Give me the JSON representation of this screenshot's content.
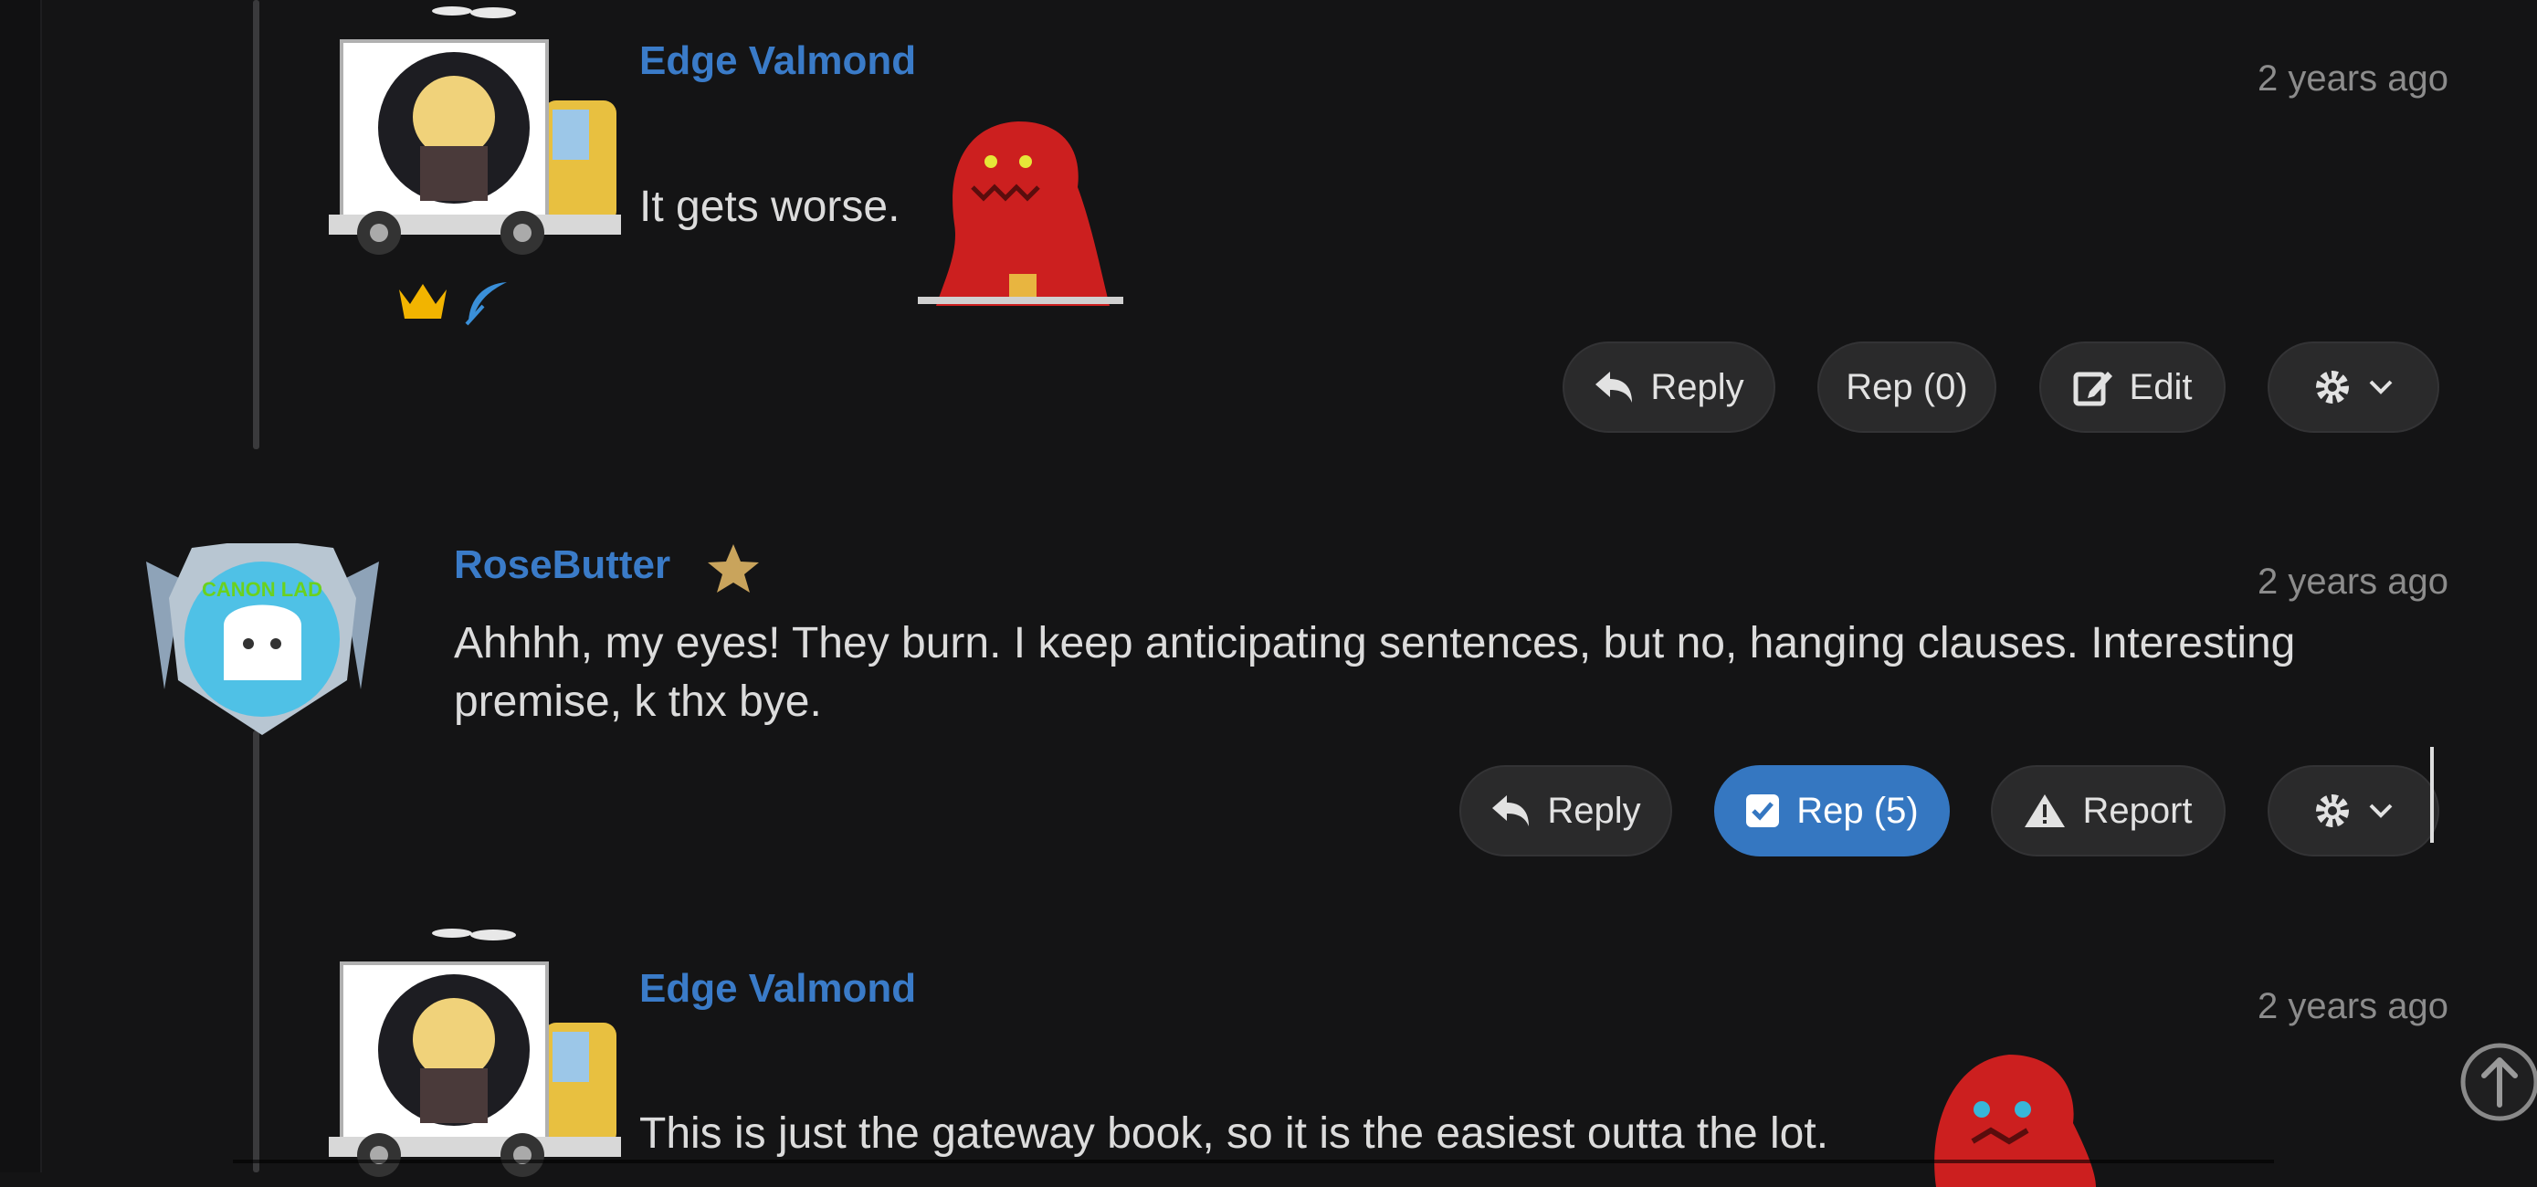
{
  "comments": [
    {
      "author": "Edge Valmond",
      "time": "2 years ago",
      "text": "It gets worse.",
      "badges": [
        "crown-icon",
        "feather-icon"
      ],
      "actions": {
        "reply": "Reply",
        "rep": "Rep (0)",
        "edit": "Edit"
      }
    },
    {
      "author": "RoseButter",
      "time": "2 years ago",
      "text_line1": "Ahhhh, my eyes! They burn. I keep anticipating sentences, but no, hanging clauses. Interesting",
      "text_line2": "premise, k thx bye.",
      "emblem_text": "CANON LAD",
      "actions": {
        "reply": "Reply",
        "rep": "Rep (5)",
        "report": "Report"
      }
    },
    {
      "author": "Edge Valmond",
      "time": "2 years ago",
      "text": "This is just the gateway book, so it is the easiest outta the lot."
    }
  ],
  "colors": {
    "link": "#3a7bc8",
    "rep_active": "#3577c1",
    "gold": "#f2b400",
    "star": "#c9a45c"
  }
}
